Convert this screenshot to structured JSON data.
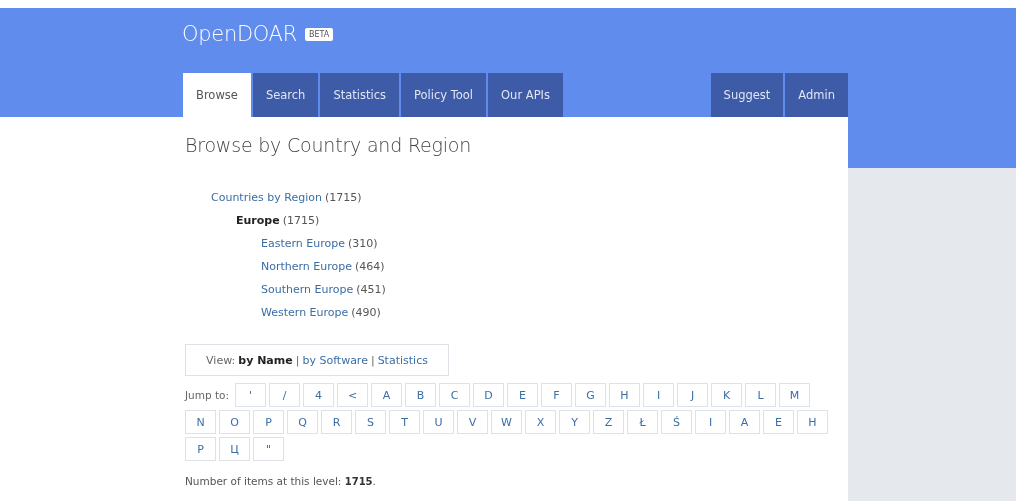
{
  "header": {
    "logo": "OpenDOAR",
    "badge": "BETA"
  },
  "tabs": [
    {
      "label": "Browse",
      "selected": true
    },
    {
      "label": "Search",
      "selected": false
    },
    {
      "label": "Statistics",
      "selected": false
    },
    {
      "label": "Policy Tool",
      "selected": false
    },
    {
      "label": "Our APIs",
      "selected": false
    }
  ],
  "right_tabs": [
    {
      "label": "Suggest",
      "selected": false
    },
    {
      "label": "Admin",
      "selected": false
    }
  ],
  "heading": "Browse by Country and Region",
  "tree": [
    {
      "name": "Countries by Region",
      "count": "(1715)",
      "current": false,
      "children": [
        {
          "name": "Europe",
          "count": "(1715)",
          "current": true,
          "children": [
            {
              "name": "Eastern Europe",
              "count": "(310)",
              "current": false
            },
            {
              "name": "Northern Europe",
              "count": "(464)",
              "current": false
            },
            {
              "name": "Southern Europe",
              "count": "(451)",
              "current": false
            },
            {
              "name": "Western Europe",
              "count": "(490)",
              "current": false
            }
          ]
        }
      ]
    }
  ],
  "view": {
    "label": "View:",
    "separator": "|",
    "options": [
      {
        "label": "by Name",
        "selected": true
      },
      {
        "label": "by Software",
        "selected": false
      },
      {
        "label": "Statistics",
        "selected": false
      }
    ]
  },
  "jump": {
    "label": "Jump to:",
    "letters": [
      "'",
      "/",
      "4",
      "<",
      "A",
      "B",
      "C",
      "D",
      "E",
      "F",
      "G",
      "H",
      "I",
      "J",
      "K",
      "L",
      "M",
      "N",
      "O",
      "P",
      "Q",
      "R",
      "S",
      "T",
      "U",
      "V",
      "W",
      "X",
      "Y",
      "Z",
      "Ł",
      "Ś",
      "І",
      "А",
      "Е",
      "Н",
      "Р",
      "Ц",
      "\""
    ]
  },
  "footer": {
    "label": "Number of items at this level:",
    "count": "1715",
    "end": "."
  }
}
